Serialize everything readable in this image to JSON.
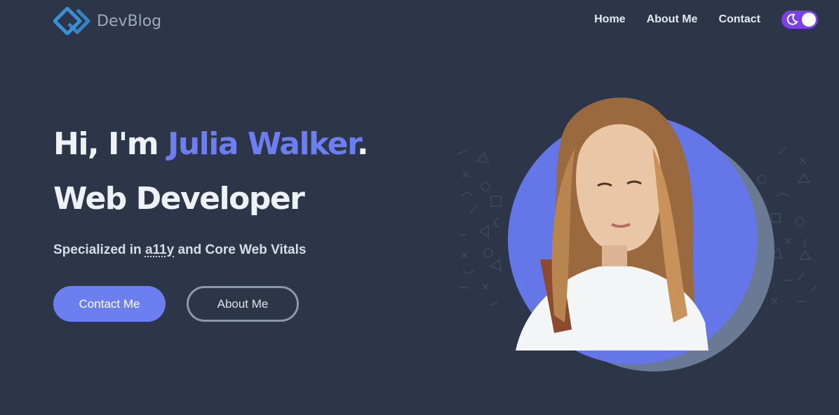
{
  "brand": {
    "name": "DevBlog",
    "icon": "diamond-logo-icon"
  },
  "nav": {
    "links": [
      {
        "label": "Home"
      },
      {
        "label": "About Me"
      },
      {
        "label": "Contact"
      }
    ],
    "theme_toggle": {
      "icon": "moon-icon",
      "state": "dark"
    }
  },
  "hero": {
    "greeting": "Hi, I'm ",
    "name": "Julia Walker",
    "period": ".",
    "role": "Web Developer",
    "tagline_prefix": "Specialized in ",
    "tagline_abbr": "a11y",
    "tagline_suffix": " and Core Web Vitals"
  },
  "buttons": {
    "primary": "Contact Me",
    "secondary": "About Me"
  },
  "portrait": {
    "icon": "portrait-photo"
  },
  "colors": {
    "background": "#2d3648",
    "accent": "#6c7ef0",
    "toggle": "#7d3fe8",
    "shadow_circle": "#6b7a94"
  }
}
